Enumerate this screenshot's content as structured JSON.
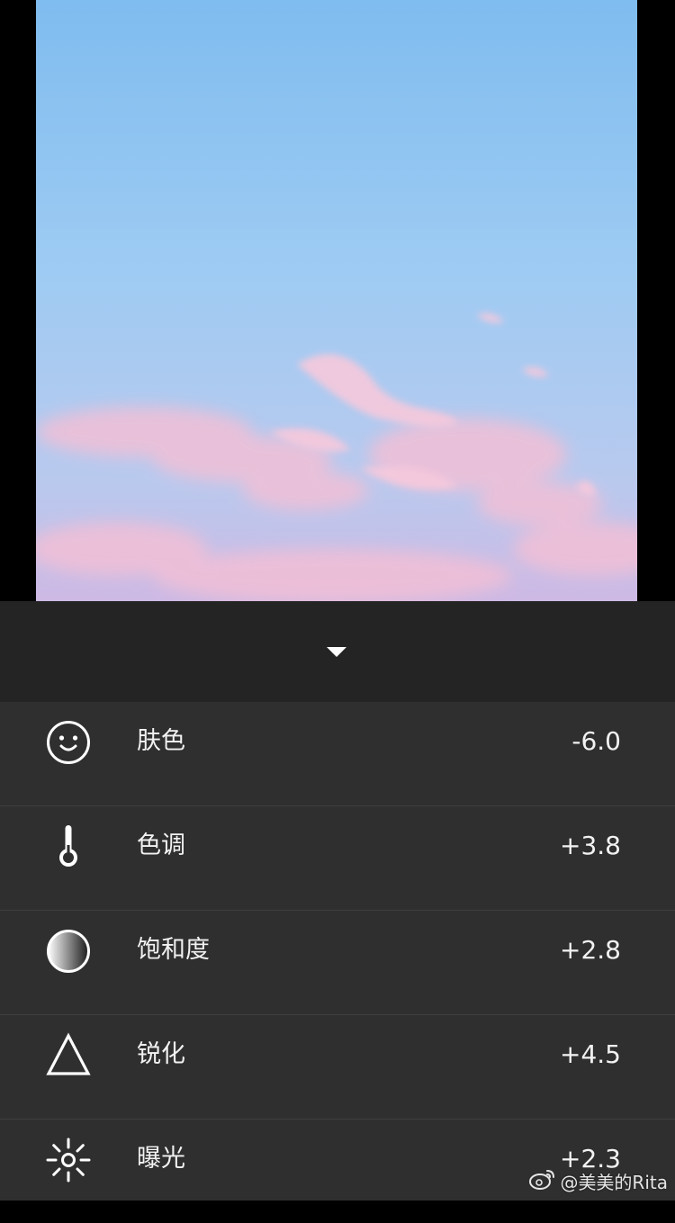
{
  "photo": {
    "description_icon": "image-preview"
  },
  "panel": {
    "collapse_icon": "caret-down-icon"
  },
  "adjustments": [
    {
      "label": "肤色",
      "value": "-6.0",
      "icon": "face-icon"
    },
    {
      "label": "色调",
      "value": "+3.8",
      "icon": "thermometer-icon"
    },
    {
      "label": "饱和度",
      "value": "+2.8",
      "icon": "gradient-circle-icon"
    },
    {
      "label": "锐化",
      "value": "+4.5",
      "icon": "triangle-icon"
    },
    {
      "label": "曝光",
      "value": "+2.3",
      "icon": "sun-icon"
    }
  ],
  "watermark": {
    "text": "@美美的Rita",
    "icon": "weibo-icon"
  },
  "colors": {
    "panel_bg": "#2f2f2f",
    "header_bg": "#242424",
    "divider": "#3e3e3e",
    "text": "#f2f2f2"
  }
}
